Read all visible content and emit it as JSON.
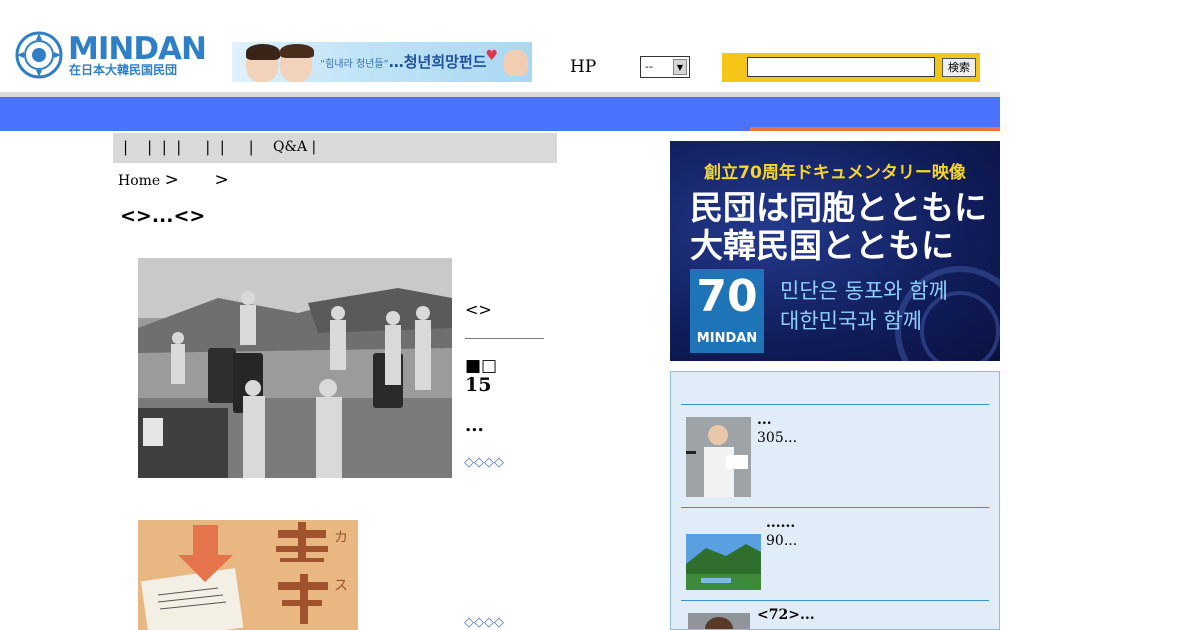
{
  "header": {
    "logo_word": "MINDAN",
    "logo_sub": "在日本大韓民国民団",
    "banner_small": "“힘내라 청년들”",
    "banner_text": "…청년희망펀드",
    "hp_label": "HP",
    "language_select_value": "--",
    "search_placeholder": "",
    "search_button": "検索"
  },
  "nav": {
    "separators": "|    |  |  |     |  |     |",
    "qa_label": "Q&A |"
  },
  "breadcrumb": {
    "home": "Home",
    "sep1": ">",
    "sep2": ">"
  },
  "page_title": "<>...<>",
  "article1": {
    "tag": "<>",
    "mark": "■□",
    "number": "15",
    "dots": "...",
    "more": "◇◇◇◇"
  },
  "article2": {
    "more": "◇◇◇◇"
  },
  "ad": {
    "jp_top": "創立70周年ドキュメンタリー映像",
    "jp_big": "民団は同胞とともに\n大韓民国とともに",
    "logo_number": "70",
    "logo_text": "MINDAN",
    "kr_text": "민단은 동포와 함께\n대한민국과 함께"
  },
  "side_items": [
    {
      "title": "...",
      "text": "305..."
    },
    {
      "title": "......",
      "text": "90..."
    },
    {
      "title": "<72>...",
      "text": ""
    }
  ],
  "colors": {
    "brand_blue": "#2f7fc6",
    "header_bar": "#4a73ff",
    "accent_orange": "#e9753a",
    "search_yellow": "#f5c518",
    "link_blue": "#4670c8"
  }
}
